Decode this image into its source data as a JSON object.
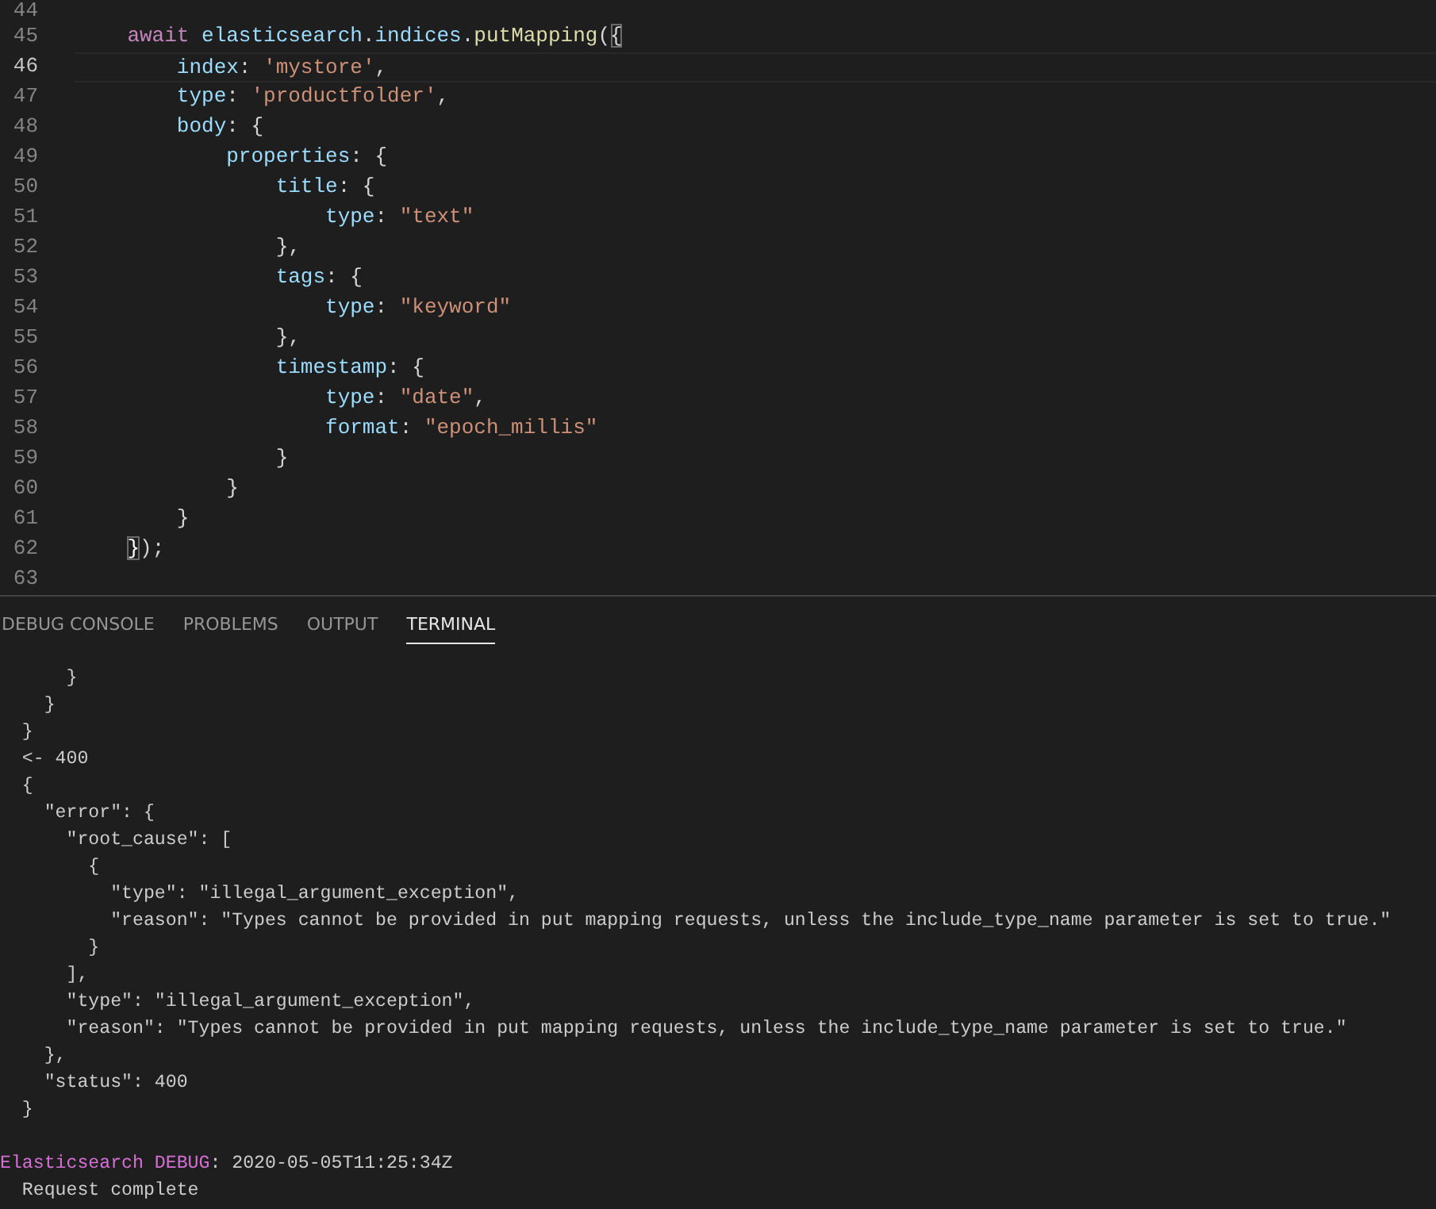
{
  "editor": {
    "lines": [
      {
        "number": "44",
        "current": false
      },
      {
        "number": "45",
        "current": false,
        "tokens": [
          {
            "kind": "kw",
            "text": "    await"
          },
          {
            "kind": "var",
            "text": " elasticsearch"
          },
          {
            "kind": "punct",
            "text": "."
          },
          {
            "kind": "var",
            "text": "indices"
          },
          {
            "kind": "punct",
            "text": "."
          },
          {
            "kind": "fn",
            "text": "putMapping"
          },
          {
            "kind": "punct",
            "text": "("
          },
          {
            "kind": "match",
            "text": "{"
          }
        ]
      },
      {
        "number": "46",
        "current": true,
        "tokens": [
          {
            "kind": "prop",
            "text": "        index"
          },
          {
            "kind": "punct",
            "text": ": "
          },
          {
            "kind": "str",
            "text": "'mystore'"
          },
          {
            "kind": "punct",
            "text": ","
          }
        ]
      },
      {
        "number": "47",
        "current": false,
        "tokens": [
          {
            "kind": "prop",
            "text": "        type"
          },
          {
            "kind": "punct",
            "text": ": "
          },
          {
            "kind": "str",
            "text": "'productfolder'"
          },
          {
            "kind": "punct",
            "text": ","
          }
        ]
      },
      {
        "number": "48",
        "current": false,
        "tokens": [
          {
            "kind": "prop",
            "text": "        body"
          },
          {
            "kind": "punct",
            "text": ": {"
          }
        ]
      },
      {
        "number": "49",
        "current": false,
        "tokens": [
          {
            "kind": "prop",
            "text": "            properties"
          },
          {
            "kind": "punct",
            "text": ": {"
          }
        ]
      },
      {
        "number": "50",
        "current": false,
        "tokens": [
          {
            "kind": "prop",
            "text": "                title"
          },
          {
            "kind": "punct",
            "text": ": {"
          }
        ]
      },
      {
        "number": "51",
        "current": false,
        "tokens": [
          {
            "kind": "prop",
            "text": "                    type"
          },
          {
            "kind": "punct",
            "text": ": "
          },
          {
            "kind": "str",
            "text": "\"text\""
          }
        ]
      },
      {
        "number": "52",
        "current": false,
        "tokens": [
          {
            "kind": "punct",
            "text": "                },"
          }
        ]
      },
      {
        "number": "53",
        "current": false,
        "tokens": [
          {
            "kind": "prop",
            "text": "                tags"
          },
          {
            "kind": "punct",
            "text": ": {"
          }
        ]
      },
      {
        "number": "54",
        "current": false,
        "tokens": [
          {
            "kind": "prop",
            "text": "                    type"
          },
          {
            "kind": "punct",
            "text": ": "
          },
          {
            "kind": "str",
            "text": "\"keyword\""
          }
        ]
      },
      {
        "number": "55",
        "current": false,
        "tokens": [
          {
            "kind": "punct",
            "text": "                },"
          }
        ]
      },
      {
        "number": "56",
        "current": false,
        "tokens": [
          {
            "kind": "prop",
            "text": "                timestamp"
          },
          {
            "kind": "punct",
            "text": ": {"
          }
        ]
      },
      {
        "number": "57",
        "current": false,
        "tokens": [
          {
            "kind": "prop",
            "text": "                    type"
          },
          {
            "kind": "punct",
            "text": ": "
          },
          {
            "kind": "str",
            "text": "\"date\""
          },
          {
            "kind": "punct",
            "text": ","
          }
        ]
      },
      {
        "number": "58",
        "current": false,
        "tokens": [
          {
            "kind": "prop",
            "text": "                    format"
          },
          {
            "kind": "punct",
            "text": ": "
          },
          {
            "kind": "str",
            "text": "\"epoch_millis\""
          }
        ]
      },
      {
        "number": "59",
        "current": false,
        "tokens": [
          {
            "kind": "punct",
            "text": "                }"
          }
        ]
      },
      {
        "number": "60",
        "current": false,
        "tokens": [
          {
            "kind": "punct",
            "text": "            }"
          }
        ]
      },
      {
        "number": "61",
        "current": false,
        "tokens": [
          {
            "kind": "punct",
            "text": "        }"
          }
        ]
      },
      {
        "number": "62",
        "current": false,
        "tokens": [
          {
            "kind": "match",
            "text": "    }"
          },
          {
            "kind": "punct",
            "text": ");"
          }
        ]
      },
      {
        "number": "63",
        "current": false
      }
    ]
  },
  "panel_tabs": [
    {
      "label": "DEBUG CONSOLE",
      "selected": false
    },
    {
      "label": "PROBLEMS",
      "selected": false
    },
    {
      "label": "OUTPUT",
      "selected": false
    },
    {
      "label": "TERMINAL",
      "selected": true
    }
  ],
  "terminal": {
    "lines": [
      [
        {
          "kind": "plain",
          "text": "      }"
        }
      ],
      [
        {
          "kind": "plain",
          "text": "    }"
        }
      ],
      [
        {
          "kind": "plain",
          "text": "  }"
        }
      ],
      [
        {
          "kind": "plain",
          "text": "  <- 400"
        }
      ],
      [
        {
          "kind": "plain",
          "text": "  {"
        }
      ],
      [
        {
          "kind": "plain",
          "text": "    \"error\": {"
        }
      ],
      [
        {
          "kind": "plain",
          "text": "      \"root_cause\": ["
        }
      ],
      [
        {
          "kind": "plain",
          "text": "        {"
        }
      ],
      [
        {
          "kind": "plain",
          "text": "          \"type\": \"illegal_argument_exception\","
        }
      ],
      [
        {
          "kind": "plain",
          "text": "          \"reason\": \"Types cannot be provided in put mapping requests, unless the include_type_name parameter is set to true.\""
        }
      ],
      [
        {
          "kind": "plain",
          "text": "        }"
        }
      ],
      [
        {
          "kind": "plain",
          "text": "      ],"
        }
      ],
      [
        {
          "kind": "plain",
          "text": "      \"type\": \"illegal_argument_exception\","
        }
      ],
      [
        {
          "kind": "plain",
          "text": "      \"reason\": \"Types cannot be provided in put mapping requests, unless the include_type_name parameter is set to true.\""
        }
      ],
      [
        {
          "kind": "plain",
          "text": "    },"
        }
      ],
      [
        {
          "kind": "plain",
          "text": "    \"status\": 400"
        }
      ],
      [
        {
          "kind": "plain",
          "text": "  }"
        }
      ],
      [
        {
          "kind": "label",
          "text": "Elasticsearch DEBUG"
        },
        {
          "kind": "plain",
          "text": ": 2020-05-05T11:25:34Z"
        }
      ],
      [
        {
          "kind": "plain",
          "text": "  Request complete"
        }
      ]
    ]
  }
}
